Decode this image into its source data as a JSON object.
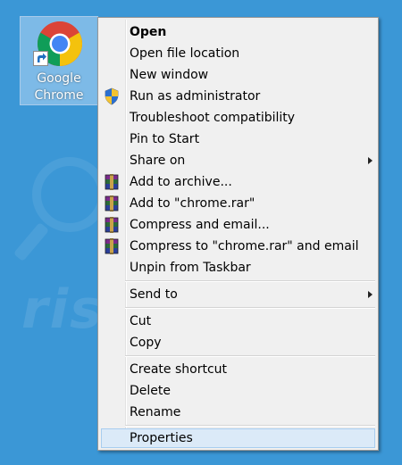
{
  "desktop": {
    "background": "#3b97d6",
    "watermark": "rish.com"
  },
  "shortcut": {
    "label_line1": "Google",
    "label_line2": "Chrome",
    "icon": "chrome-logo-icon"
  },
  "menu": {
    "items": [
      {
        "label": "Open",
        "bold": true
      },
      {
        "label": "Open file location"
      },
      {
        "label": "New window"
      },
      {
        "label": "Run as administrator",
        "icon": "uac-shield-icon"
      },
      {
        "label": "Troubleshoot compatibility"
      },
      {
        "label": "Pin to Start"
      },
      {
        "label": "Share on",
        "submenu": true
      },
      {
        "label": "Add to archive...",
        "icon": "winrar-icon"
      },
      {
        "label": "Add to \"chrome.rar\"",
        "icon": "winrar-icon"
      },
      {
        "label": "Compress and email...",
        "icon": "winrar-icon"
      },
      {
        "label": "Compress to \"chrome.rar\" and email",
        "icon": "winrar-icon"
      },
      {
        "label": "Unpin from Taskbar"
      },
      {
        "label": "Send to",
        "submenu": true
      },
      {
        "label": "Cut"
      },
      {
        "label": "Copy"
      },
      {
        "label": "Create shortcut"
      },
      {
        "label": "Delete"
      },
      {
        "label": "Rename"
      },
      {
        "label": "Properties",
        "selected": true
      }
    ]
  }
}
